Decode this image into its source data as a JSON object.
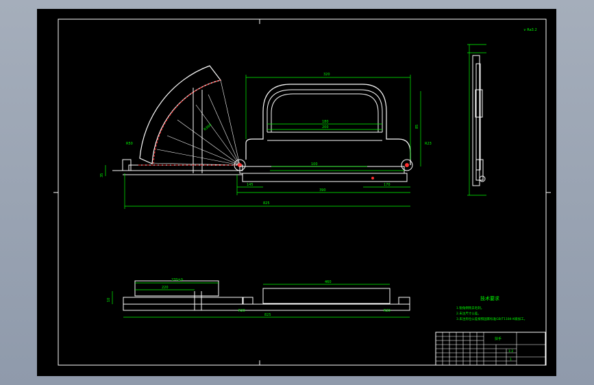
{
  "drawing": {
    "roughness_symbol": "∨ Ra3.2",
    "tech_requirements": {
      "title": "技术要求",
      "items": [
        "1.锐角倒钝去毛刺。",
        "2.未注尺寸公差。",
        "3.未注形位公差按照国家标准GB/T1184-K级加工。"
      ]
    },
    "title_block": {
      "part_name": "扶手",
      "scale": "1:2",
      "sheet": "1"
    },
    "dimensions": {
      "side_view": {
        "overall_length": "825",
        "span_right": "390",
        "handle_width": "320",
        "handle_inner": "180",
        "handle_inner2": "200",
        "base_segment": "100",
        "right_segment": "170",
        "left_segment": "145",
        "height": "35",
        "arc_radius_small": "R50",
        "arc_radius_large": "R360",
        "hinge_radius": "R23",
        "handle_height": "85"
      },
      "bottom_view": {
        "overall_length": "825",
        "segment_left": "270±0",
        "segment_left_inner": "220",
        "segment_right": "460",
        "slot_left": "R20",
        "slot_right": "R20",
        "height": "10"
      }
    }
  }
}
